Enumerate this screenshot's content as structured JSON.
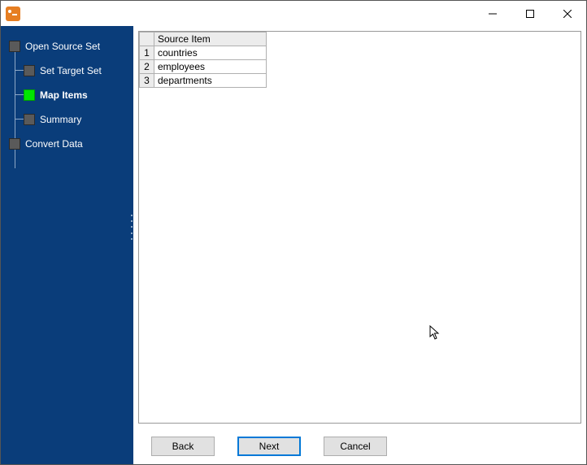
{
  "window": {
    "title": ""
  },
  "sidebar": {
    "steps": [
      {
        "label": "Open Source Set",
        "level": 1,
        "active": false
      },
      {
        "label": "Set Target Set",
        "level": 2,
        "active": false
      },
      {
        "label": "Map Items",
        "level": 2,
        "active": true
      },
      {
        "label": "Summary",
        "level": 2,
        "active": false
      },
      {
        "label": "Convert Data",
        "level": 1,
        "active": false
      }
    ]
  },
  "table": {
    "column_header": "Source Item",
    "rows": [
      {
        "n": "1",
        "item": "countries"
      },
      {
        "n": "2",
        "item": "employees"
      },
      {
        "n": "3",
        "item": "departments"
      }
    ]
  },
  "buttons": {
    "back": "Back",
    "next": "Next",
    "cancel": "Cancel"
  }
}
